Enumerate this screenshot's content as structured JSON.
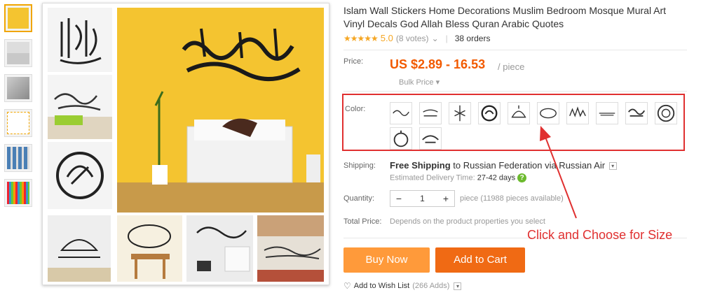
{
  "product": {
    "title": "Islam Wall Stickers Home Decorations Muslim Bedroom Mosque Mural Art Vinyl Decals God Allah Bless Quran Arabic Quotes",
    "stars": "★★★★★",
    "rating": "5.0",
    "votes": "(8 votes)",
    "votes_caret": "⌄",
    "divider": "|",
    "orders": "38 orders"
  },
  "price": {
    "label": "Price:",
    "range": "US $2.89 - 16.53",
    "unit": "/ piece",
    "bulk": "Bulk Price ▾"
  },
  "color": {
    "label": "Color:",
    "swatch_count": 12,
    "selected_index": null
  },
  "shipping": {
    "label": "Shipping:",
    "free": "Free Shipping",
    "to": " to Russian Federation via Russian Air",
    "dropdown_icon": "chevron-down-icon",
    "delivery_label": "Estimated Delivery Time: ",
    "delivery_days": "27-42 days",
    "help_glyph": "?"
  },
  "quantity": {
    "label": "Quantity:",
    "minus": "−",
    "value": "1",
    "plus": "+",
    "available": "piece (11988 pieces available)"
  },
  "total": {
    "label": "Total Price:",
    "value": "Depends on the product properties you select"
  },
  "actions": {
    "buy_now": "Buy Now",
    "add_to_cart": "Add to Cart",
    "wishlist": "Add to Wish List",
    "wishlist_count": "(266 Adds)",
    "wishlist_caret": "⌄",
    "heart_glyph": "♡"
  },
  "annotation": {
    "text": "Click and Choose for Size",
    "color": "#e03030"
  },
  "colors": {
    "accent_orange": "#f25a00",
    "buy_now_bg": "#ff9a3a",
    "add_to_cart_bg": "#f06a14",
    "hero_wall": "#f4c430",
    "star": "#f5a623"
  }
}
